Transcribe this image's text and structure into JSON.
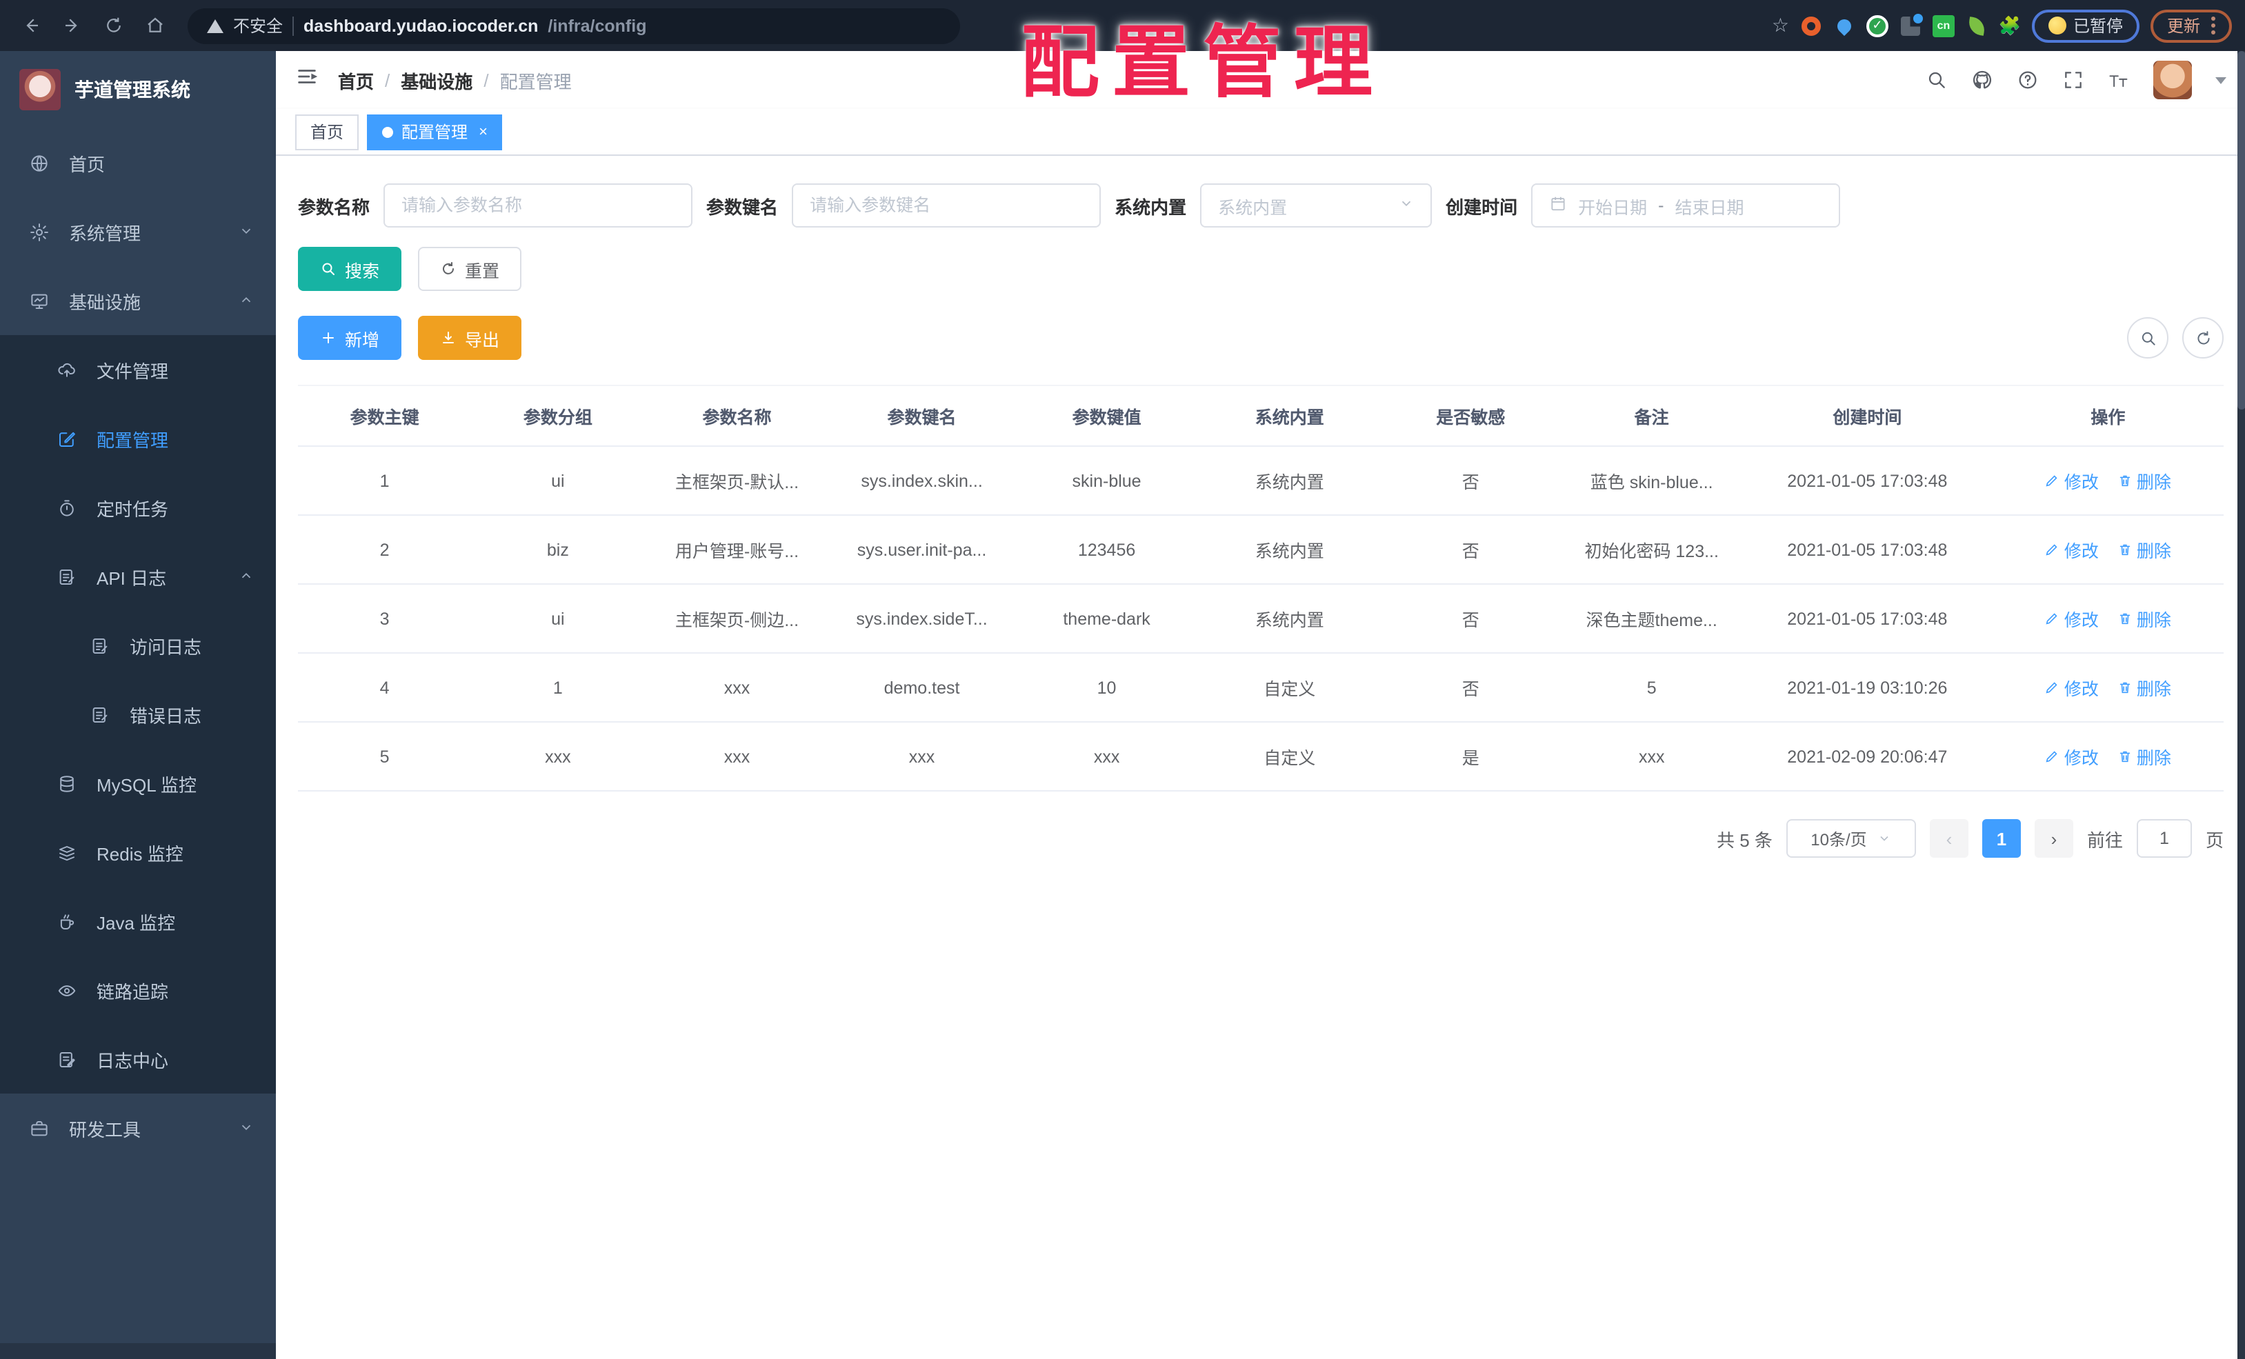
{
  "colors": {
    "accent_blue": "#409eff",
    "teal_search": "#17b3a3",
    "orange_export": "#f0a020",
    "overlay_red": "#ee2450",
    "sidebar_bg": "#304156",
    "submenu_bg": "#1f2d3d",
    "browser_bar": "#1d2634"
  },
  "browser": {
    "security_label": "不安全",
    "url_host": "dashboard.yudao.iocoder.cn",
    "url_path": "/infra/config",
    "ext_cn_badge": "cn",
    "paused_button": "已暂停",
    "update_button": "更新"
  },
  "overlay": {
    "title": "配置管理"
  },
  "sidebar": {
    "app_title": "芋道管理系统",
    "items": [
      {
        "label": "首页"
      },
      {
        "label": "系统管理"
      },
      {
        "label": "基础设施"
      },
      {
        "label": "文件管理"
      },
      {
        "label": "配置管理"
      },
      {
        "label": "定时任务"
      },
      {
        "label": "API 日志"
      },
      {
        "label": "访问日志"
      },
      {
        "label": "错误日志"
      },
      {
        "label": "MySQL 监控"
      },
      {
        "label": "Redis 监控"
      },
      {
        "label": "Java 监控"
      },
      {
        "label": "链路追踪"
      },
      {
        "label": "日志中心"
      },
      {
        "label": "研发工具"
      }
    ]
  },
  "header": {
    "breadcrumb": {
      "home": "首页",
      "section": "基础设施",
      "current": "配置管理"
    }
  },
  "tabs": {
    "home": "首页",
    "current": "配置管理",
    "close": "×"
  },
  "filters": {
    "name_label": "参数名称",
    "name_placeholder": "请输入参数名称",
    "key_label": "参数键名",
    "key_placeholder": "请输入参数键名",
    "builtin_label": "系统内置",
    "builtin_placeholder": "系统内置",
    "date_label": "创建时间",
    "date_start": "开始日期",
    "date_sep": "-",
    "date_end": "结束日期",
    "search": "搜索",
    "reset": "重置"
  },
  "toolbar": {
    "add": "新增",
    "export": "导出"
  },
  "table": {
    "columns": [
      "参数主键",
      "参数分组",
      "参数名称",
      "参数键名",
      "参数键值",
      "系统内置",
      "是否敏感",
      "备注",
      "创建时间",
      "操作"
    ],
    "rows": [
      [
        "1",
        "ui",
        "主框架页-默认...",
        "sys.index.skin...",
        "skin-blue",
        "系统内置",
        "否",
        "蓝色 skin-blue...",
        "2021-01-05 17:03:48"
      ],
      [
        "2",
        "biz",
        "用户管理-账号...",
        "sys.user.init-pa...",
        "123456",
        "系统内置",
        "否",
        "初始化密码 123...",
        "2021-01-05 17:03:48"
      ],
      [
        "3",
        "ui",
        "主框架页-侧边...",
        "sys.index.sideT...",
        "theme-dark",
        "系统内置",
        "否",
        "深色主题theme...",
        "2021-01-05 17:03:48"
      ],
      [
        "4",
        "1",
        "xxx",
        "demo.test",
        "10",
        "自定义",
        "否",
        "5",
        "2021-01-19 03:10:26"
      ],
      [
        "5",
        "xxx",
        "xxx",
        "xxx",
        "xxx",
        "自定义",
        "是",
        "xxx",
        "2021-02-09 20:06:47"
      ]
    ],
    "row_actions": {
      "edit": "修改",
      "remove": "删除"
    }
  },
  "pagination": {
    "total": "共 5 条",
    "page_size": "10条/页",
    "current_page": "1",
    "goto_label": "前往",
    "goto_value": "1",
    "page_unit": "页"
  }
}
